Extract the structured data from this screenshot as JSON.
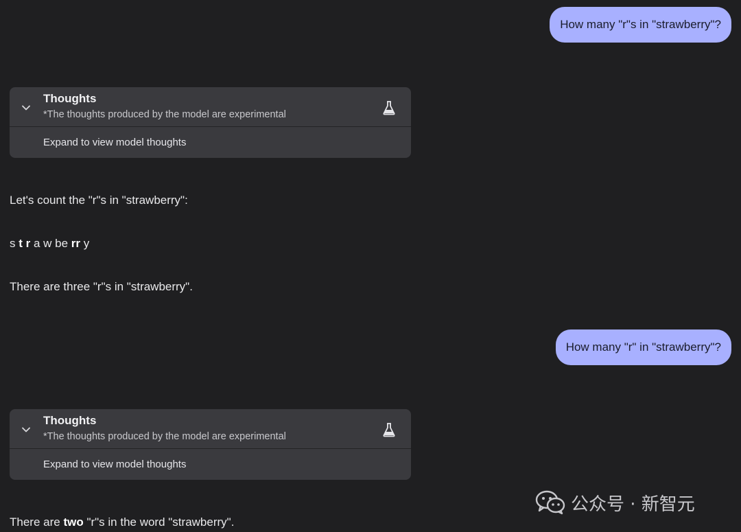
{
  "conversation": {
    "q1": "How many \"r\"s in \"strawberry\"?",
    "thoughts1": {
      "title": "Thoughts",
      "subtitle": "*The thoughts produced by the model are experimental",
      "expand": "Expand to view model thoughts"
    },
    "a1_line1": "Let's count the \"r\"s in \"strawberry\":",
    "a1_spelled": {
      "p1": "s ",
      "b1": "t r",
      "p2": " a w be ",
      "b2": "rr",
      "p3": " y"
    },
    "a1_line3": "There are three \"r\"s in \"strawberry\".",
    "q2": "How many \"r\" in \"strawberry\"?",
    "thoughts2": {
      "title": "Thoughts",
      "subtitle": "*The thoughts produced by the model are experimental",
      "expand": "Expand to view model thoughts"
    },
    "a2": {
      "pre": "There are ",
      "bold": "two",
      "post": " \"r\"s in the word \"strawberry\"."
    }
  },
  "watermark": {
    "text": "公众号 · 新智元",
    "icon": "wechat-icon"
  },
  "colors": {
    "background": "#1f1f21",
    "user_bubble": "#a8b0ff",
    "thoughts_panel": "#3a3a3e"
  }
}
